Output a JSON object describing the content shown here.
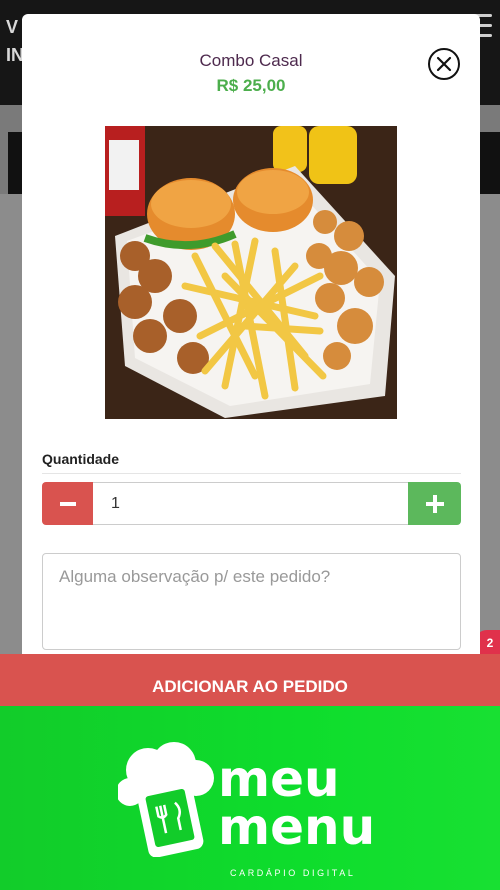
{
  "background": {
    "header_letters": [
      "V",
      "IN"
    ]
  },
  "product": {
    "name": "Combo Casal",
    "price": "R$ 25,00"
  },
  "quantity": {
    "label": "Quantidade",
    "value": "1",
    "minus_symbol": "−",
    "plus_symbol": "+"
  },
  "notes": {
    "placeholder": "Alguma observação p/ este pedido?"
  },
  "actions": {
    "add_label": "ADICIONAR AO PEDIDO"
  },
  "cart_badge": "2",
  "brand": {
    "line1": "meu",
    "line2": "menu",
    "tagline": "CARDÁPIO DIGITAL"
  },
  "colors": {
    "danger": "#d9534f",
    "success": "#5cb85c",
    "price": "#4cae4c",
    "title": "#4e2a4e",
    "brand_green": "#12cc2a"
  },
  "icons": {
    "close": "close-circle-icon",
    "menu": "hamburger-menu-icon",
    "logo": "chef-hat-phone-icon"
  }
}
